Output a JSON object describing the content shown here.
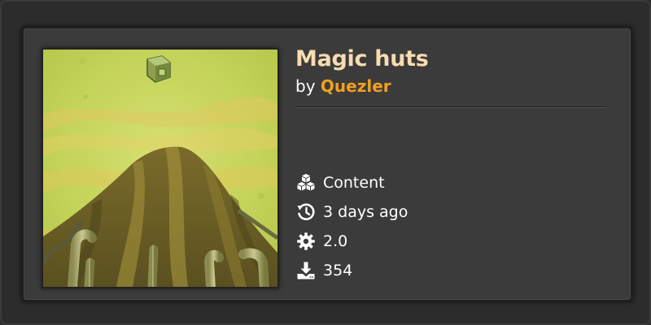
{
  "mod": {
    "title": "Magic huts",
    "by_prefix": "by",
    "author": "Quezler"
  },
  "meta": {
    "category": {
      "icon": "blocks-icon",
      "label": "Content"
    },
    "updated": {
      "icon": "history-icon",
      "label": "3 days ago"
    },
    "version": {
      "icon": "gear-icon",
      "label": "2.0"
    },
    "downloads": {
      "icon": "download-icon",
      "label": "354"
    }
  },
  "colors": {
    "title": "#f8dcb0",
    "author": "#f0a020",
    "card_bg": "#3b3b3b",
    "page_bg": "#2c2c2c"
  }
}
